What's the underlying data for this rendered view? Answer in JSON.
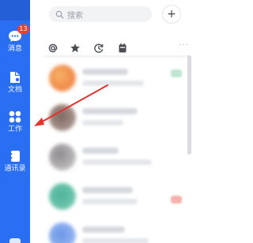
{
  "sidebar": {
    "items": [
      {
        "label": "消息",
        "icon": "chat-bubble-icon",
        "badge": "13",
        "active": true
      },
      {
        "label": "文档",
        "icon": "docs-icon"
      },
      {
        "label": "工作",
        "icon": "workspace-grid-icon"
      },
      {
        "label": "通讯录",
        "icon": "contacts-book-icon"
      }
    ]
  },
  "header": {
    "search_placeholder": "搜索",
    "add_symbol": "+"
  },
  "filter_bar": {
    "icons": [
      "at-mention-icon",
      "star-icon",
      "history-clock-icon",
      "calendar-icon"
    ],
    "more": "···"
  },
  "annotation": {
    "arrow_color": "#e5322d",
    "points_to": "工作"
  },
  "colors": {
    "sidebar_bg": "#2a6ff3",
    "badge_bg": "#ff3b30"
  }
}
